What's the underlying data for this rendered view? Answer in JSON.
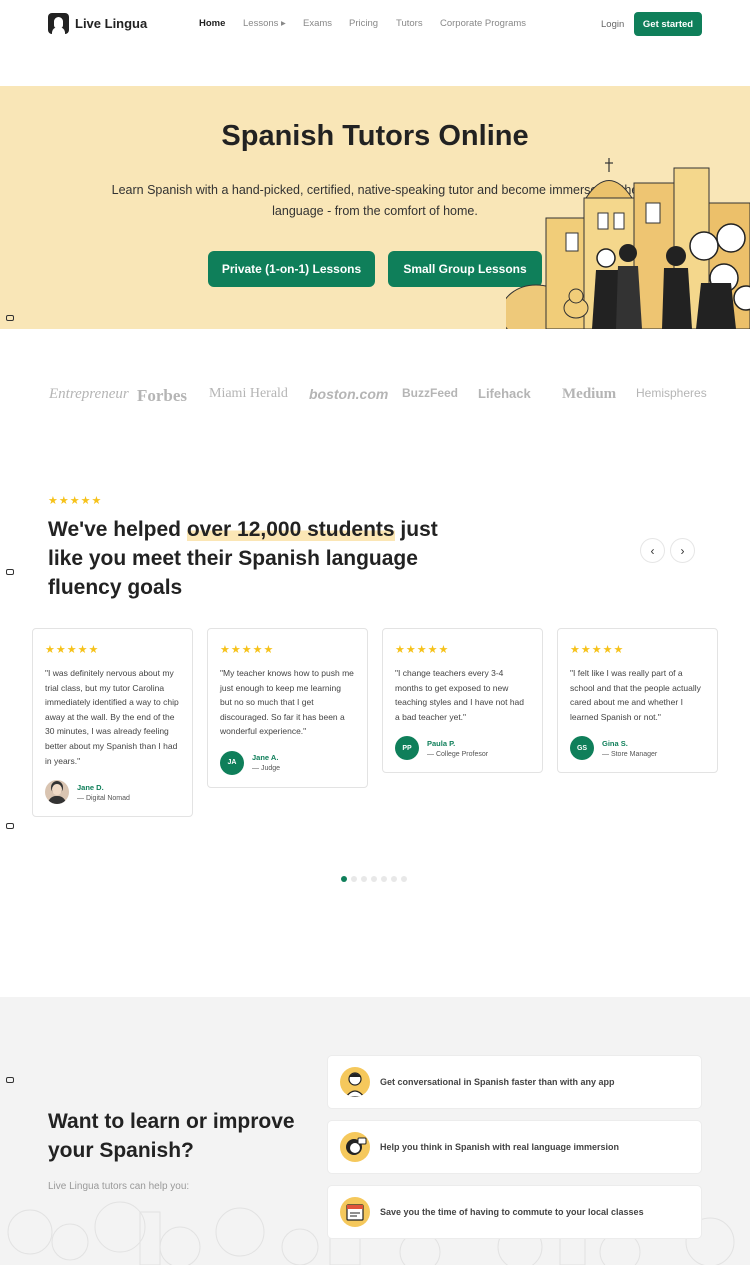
{
  "nav": {
    "logo_text": "Live Lingua",
    "items": [
      {
        "label": "Home"
      },
      {
        "label": "Lessons ▸"
      },
      {
        "label": "Exams"
      },
      {
        "label": "Pricing"
      },
      {
        "label": "Tutors"
      },
      {
        "label": "Corporate Programs"
      }
    ],
    "login": "Login",
    "cta": "Get started"
  },
  "hero": {
    "title": "Spanish Tutors Online",
    "subtitle": "Learn Spanish with a hand-picked, certified, native-speaking tutor and become immersed in the language - from the comfort of home.",
    "btn_private": "Private (1-on-1) Lessons",
    "btn_group": "Small Group Lessons"
  },
  "press": [
    "Entrepreneur",
    "Forbes",
    "Miami Herald",
    "boston.com",
    "BuzzFeed",
    "Lifehack",
    "Medium",
    "Hemispheres"
  ],
  "testimonials": {
    "stars": "★★★★★",
    "heading_before": "We've helped ",
    "heading_highlight": "over 12,000 students",
    "heading_after": " just like you meet their Spanish language fluency goals",
    "prev": "‹",
    "next": "›",
    "cards": [
      {
        "quote": "\"I was definitely nervous about my trial class, but my tutor Carolina immediately identified a way to chip away at the wall. By the end of the 30 minutes, I was already feeling better about my Spanish than I had in years.\"",
        "initials": "",
        "name": "Jane D.",
        "role": "— Digital Nomad"
      },
      {
        "quote": "\"My teacher knows how to push me just enough to keep me learning but no so much that I get discouraged. So far it has been a wonderful experience.\"",
        "initials": "JA",
        "name": "Jane A.",
        "role": "— Judge"
      },
      {
        "quote": "\"I change teachers every 3-4 months to get exposed to new teaching styles and I have not had a bad teacher yet.\"",
        "initials": "PP",
        "name": "Paula P.",
        "role": "— College Profesor"
      },
      {
        "quote": "\"I felt like I was really part of a school and that the people actually cared about me and whether I learned Spanish or not.\"",
        "initials": "GS",
        "name": "Gina S.",
        "role": "— Store Manager"
      }
    ]
  },
  "learn": {
    "title": "Want to learn or improve your Spanish?",
    "subtitle": "Live Lingua tutors can help you:",
    "benefits": [
      {
        "text": "Get conversational in Spanish faster than with any app",
        "icon": "person-icon"
      },
      {
        "text": "Help you think in Spanish with real language immersion",
        "icon": "head-speech-icon"
      },
      {
        "text": "Save you the time of having to commute to your local classes",
        "icon": "calendar-icon"
      }
    ]
  },
  "colors": {
    "brand_green": "#0f7f5a",
    "hero_bg": "#f9e6b7",
    "star": "#f6c21a"
  }
}
